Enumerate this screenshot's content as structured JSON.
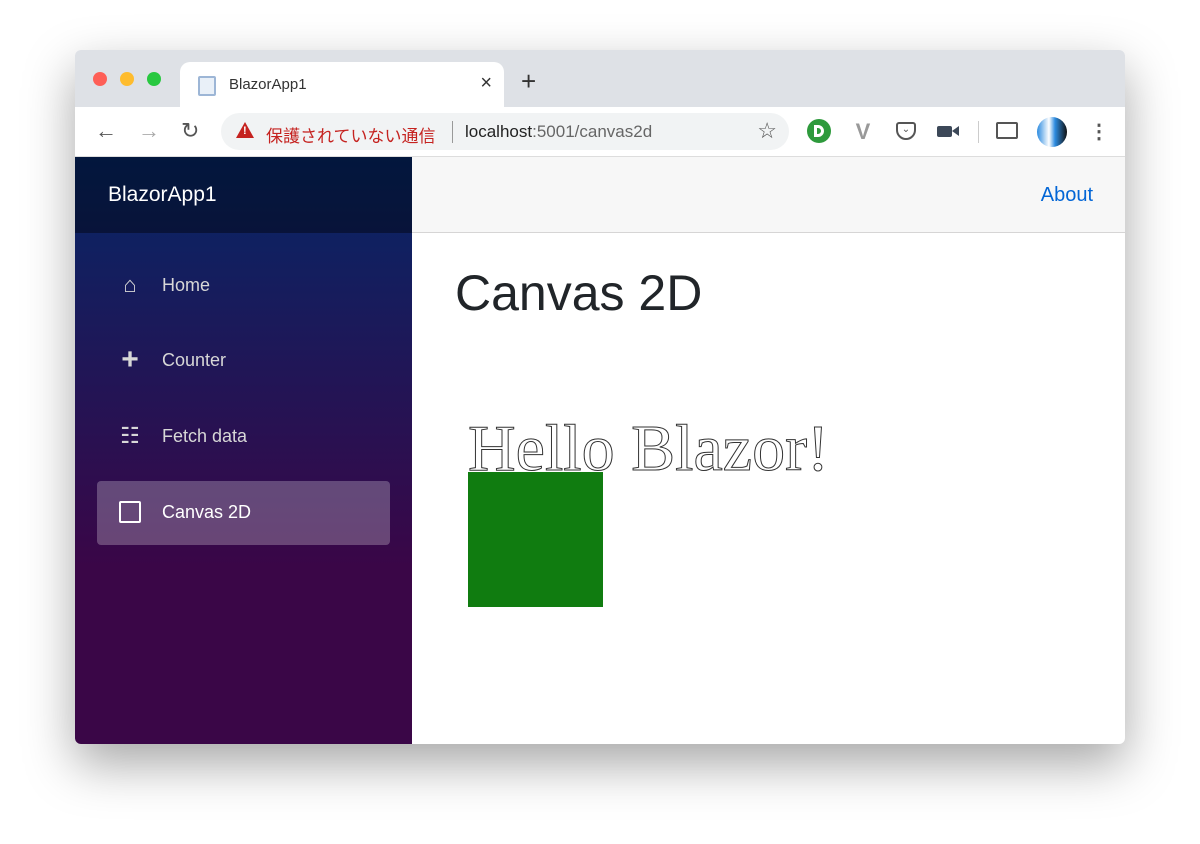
{
  "browser": {
    "tab_title": "BlazorApp1",
    "close_tab": "×",
    "new_tab": "+",
    "security_label": "保護されていない通信",
    "url_host": "localhost",
    "url_rest": ":5001/canvas2d",
    "icons": [
      "back-icon",
      "forward-icon",
      "reload-icon",
      "warning-icon",
      "star-icon",
      "extension-green-icon",
      "extension-v-icon",
      "pocket-icon",
      "video-icon",
      "cast-icon",
      "profile-avatar",
      "menu-icon"
    ]
  },
  "sidebar": {
    "brand": "BlazorApp1",
    "items": [
      {
        "label": "Home",
        "icon": "home-icon"
      },
      {
        "label": "Counter",
        "icon": "plus-icon"
      },
      {
        "label": "Fetch data",
        "icon": "list-icon"
      },
      {
        "label": "Canvas 2D",
        "icon": "image-icon",
        "active": true
      }
    ]
  },
  "header": {
    "about": "About"
  },
  "main": {
    "title": "Canvas 2D",
    "canvas_text": "Hello Blazor!",
    "rect_color": "#107c10"
  }
}
